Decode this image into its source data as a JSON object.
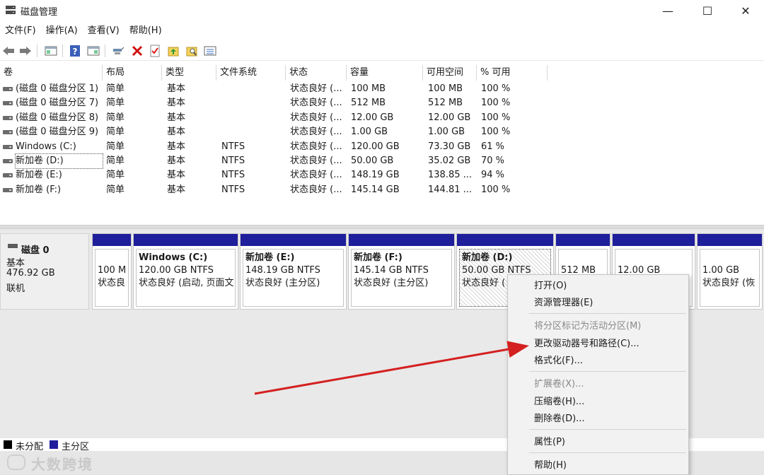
{
  "window": {
    "title": "磁盘管理",
    "controls": {
      "minimize": "—",
      "maximize": "☐",
      "close": "✕"
    }
  },
  "menubar": [
    "文件(F)",
    "操作(A)",
    "查看(V)",
    "帮助(H)"
  ],
  "toolbar": {
    "icons": [
      "back-icon",
      "forward-icon",
      "show-hide-console-tree-icon",
      "help-icon",
      "properties-icon",
      "connect-icon",
      "delete-icon",
      "check-icon",
      "folder-up-icon",
      "folder-search-icon",
      "list-view-icon"
    ]
  },
  "volume_table": {
    "columns": [
      "卷",
      "布局",
      "类型",
      "文件系统",
      "状态",
      "容量",
      "可用空间",
      "% 可用"
    ],
    "rows": [
      {
        "volume": "(磁盘 0 磁盘分区 1)",
        "layout": "简单",
        "type": "基本",
        "fs": "",
        "status": "状态良好 (...",
        "capacity": "100 MB",
        "free": "100 MB",
        "pct": "100 %"
      },
      {
        "volume": "(磁盘 0 磁盘分区 7)",
        "layout": "简单",
        "type": "基本",
        "fs": "",
        "status": "状态良好 (...",
        "capacity": "512 MB",
        "free": "512 MB",
        "pct": "100 %"
      },
      {
        "volume": "(磁盘 0 磁盘分区 8)",
        "layout": "简单",
        "type": "基本",
        "fs": "",
        "status": "状态良好 (...",
        "capacity": "12.00 GB",
        "free": "12.00 GB",
        "pct": "100 %"
      },
      {
        "volume": "(磁盘 0 磁盘分区 9)",
        "layout": "简单",
        "type": "基本",
        "fs": "",
        "status": "状态良好 (...",
        "capacity": "1.00 GB",
        "free": "1.00 GB",
        "pct": "100 %"
      },
      {
        "volume": "Windows (C:)",
        "layout": "简单",
        "type": "基本",
        "fs": "NTFS",
        "status": "状态良好 (...",
        "capacity": "120.00 GB",
        "free": "73.30 GB",
        "pct": "61 %"
      },
      {
        "volume": "新加卷 (D:)",
        "layout": "简单",
        "type": "基本",
        "fs": "NTFS",
        "status": "状态良好 (...",
        "capacity": "50.00 GB",
        "free": "35.02 GB",
        "pct": "70 %"
      },
      {
        "volume": "新加卷 (E:)",
        "layout": "简单",
        "type": "基本",
        "fs": "NTFS",
        "status": "状态良好 (...",
        "capacity": "148.19 GB",
        "free": "138.85 ...",
        "pct": "94 %"
      },
      {
        "volume": "新加卷 (F:)",
        "layout": "简单",
        "type": "基本",
        "fs": "NTFS",
        "status": "状态良好 (...",
        "capacity": "145.14 GB",
        "free": "144.81 ...",
        "pct": "100 %"
      }
    ]
  },
  "disk": {
    "name": "磁盘 0",
    "type": "基本",
    "size": "476.92 GB",
    "state": "联机"
  },
  "partitions": [
    {
      "name": "",
      "line1": "100 M",
      "line2": "状态良"
    },
    {
      "name": "Windows  (C:)",
      "line1": "120.00 GB NTFS",
      "line2": "状态良好 (启动, 页面文"
    },
    {
      "name": "新加卷  (E:)",
      "line1": "148.19 GB NTFS",
      "line2": "状态良好 (主分区)"
    },
    {
      "name": "新加卷  (F:)",
      "line1": "145.14 GB NTFS",
      "line2": "状态良好 (主分区)"
    },
    {
      "name": "新加卷  (D:)",
      "line1": "50.00 GB NTFS",
      "line2": "状态良好 ("
    },
    {
      "name": "",
      "line1": "512 MB",
      "line2": ""
    },
    {
      "name": "",
      "line1": "12.00 GB",
      "line2": ""
    },
    {
      "name": "",
      "line1": "1.00 GB",
      "line2": "状态良好 (恢"
    }
  ],
  "legend": {
    "unallocated": "未分配",
    "primary": "主分区",
    "unallocated_color": "#000000",
    "primary_color": "#1f1f9c"
  },
  "context_menu": {
    "items": [
      {
        "label": "打开(O)",
        "enabled": true
      },
      {
        "label": "资源管理器(E)",
        "enabled": true
      },
      {
        "label": "将分区标记为活动分区(M)",
        "enabled": false
      },
      {
        "label": "更改驱动器号和路径(C)...",
        "enabled": true
      },
      {
        "label": "格式化(F)...",
        "enabled": true
      },
      {
        "label": "扩展卷(X)...",
        "enabled": false
      },
      {
        "label": "压缩卷(H)...",
        "enabled": true
      },
      {
        "label": "删除卷(D)...",
        "enabled": true
      },
      {
        "label": "属性(P)",
        "enabled": true
      },
      {
        "label": "帮助(H)",
        "enabled": true
      }
    ]
  },
  "watermark": "大数跨境",
  "colors": {
    "partition_bar": "#1f1f9c",
    "annotation_arrow": "#d42020"
  }
}
